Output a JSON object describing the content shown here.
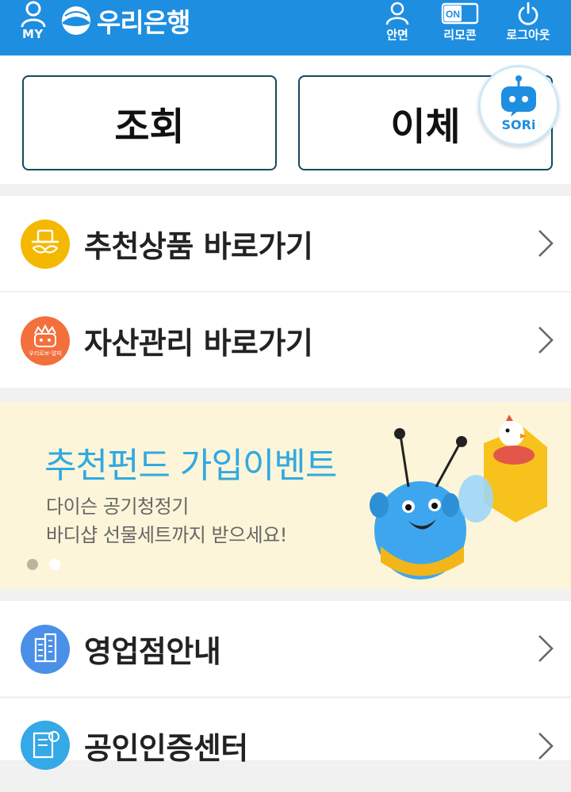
{
  "header": {
    "my_label": "MY",
    "logo_text": "우리은행",
    "face_label": "안면",
    "remote_label": "리모콘",
    "remote_toggle": "ON",
    "logout_label": "로그아웃",
    "bg_color": "#1e8ee0"
  },
  "quick": {
    "inquiry_label": "조회",
    "transfer_label": "이체",
    "sori_label": "SORi"
  },
  "menu": {
    "recommended_label": "추천상품 바로가기",
    "asset_label": "자산관리 바로가기",
    "asset_icon_text": "우리로보-알피",
    "branch_label": "영업점안내",
    "cert_label": "공인인증센터"
  },
  "banner": {
    "title": "추천펀드 가입이벤트",
    "line1": "다이슨 공기청정기",
    "line2": "바디샵 선물세트까지 받으세요!",
    "slide_count": 2,
    "active_slide": 1
  },
  "colors": {
    "accent_blue": "#1e8ee0",
    "banner_title": "#31a9e1",
    "recommended_icon_bg": "#f5b800",
    "asset_icon_bg": "#f36f3c",
    "branch_icon_bg": "#4a8fe8",
    "cert_icon_bg": "#35a8e6"
  }
}
